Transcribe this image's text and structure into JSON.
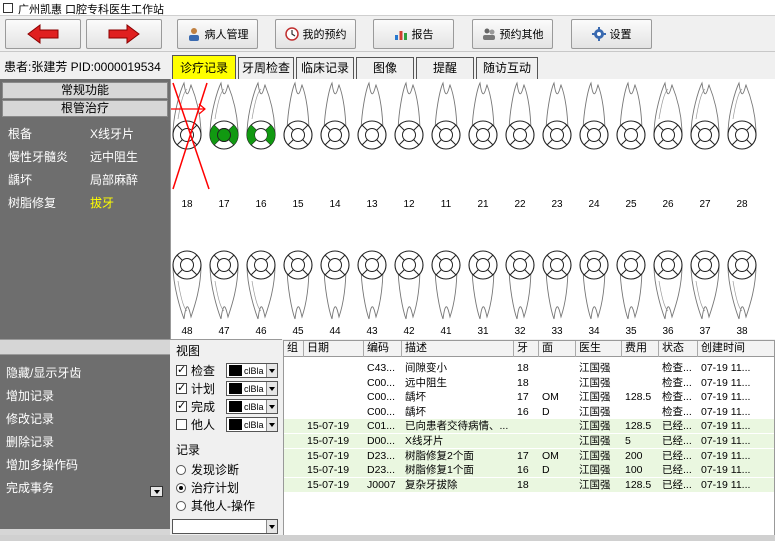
{
  "window": {
    "title": "广州凯惠  口腔专科医生工作站"
  },
  "toolbar": {
    "back_icon": "arrow-left-icon",
    "forward_icon": "arrow-right-icon",
    "buttons": [
      {
        "label": "病人管理",
        "icon": "patient-icon"
      },
      {
        "label": "我的预约",
        "icon": "appointment-icon"
      },
      {
        "label": "报告",
        "icon": "report-icon"
      },
      {
        "label": "预约其他",
        "icon": "schedule-others-icon"
      },
      {
        "label": "设置",
        "icon": "gear-icon"
      }
    ]
  },
  "patient": {
    "info": "患者:张建芳 PID:0000019534"
  },
  "tabs": [
    "诊疗记录",
    "牙周检查",
    "临床记录",
    "图像",
    "提醒",
    "随访互动"
  ],
  "left_panel": {
    "menu_common": "常规功能",
    "menu_root": "根管治疗",
    "procedures_left": [
      "根备",
      "慢性牙髓炎",
      "龋坏",
      "树脂修复"
    ],
    "procedures_right": [
      "X线牙片",
      "远中阻生",
      "局部麻醉",
      "拔牙"
    ],
    "actions": [
      "隐藏/显示牙齿",
      "增加记录",
      "修改记录",
      "删除记录",
      "增加多操作码",
      "完成事务"
    ]
  },
  "teeth": {
    "upper": [
      "18",
      "17",
      "16",
      "15",
      "14",
      "13",
      "12",
      "11",
      "21",
      "22",
      "23",
      "24",
      "25",
      "26",
      "27",
      "28"
    ],
    "lower": [
      "48",
      "47",
      "46",
      "45",
      "44",
      "43",
      "42",
      "41",
      "31",
      "32",
      "33",
      "34",
      "35",
      "36",
      "37",
      "38"
    ],
    "extracted": [
      "18"
    ],
    "filled": [
      "17",
      "16"
    ],
    "fill_color": "#119911",
    "filled_surfaces": {
      "17": "occlusal+distal",
      "16": "distal"
    },
    "mark_color": "#ff0000"
  },
  "view": {
    "title": "视图",
    "checks": [
      {
        "label": "检查",
        "checked": true,
        "color": "clBla"
      },
      {
        "label": "计划",
        "checked": true,
        "color": "clBla"
      },
      {
        "label": "完成",
        "checked": true,
        "color": "clBla"
      },
      {
        "label": "他人",
        "checked": false,
        "color": "clBla"
      }
    ],
    "record_title": "记录",
    "radios": [
      {
        "label": "发现诊断",
        "on": false
      },
      {
        "label": "治疗计划",
        "on": true
      },
      {
        "label": "其他人-操作",
        "on": false
      }
    ]
  },
  "grid": {
    "headers": [
      "组",
      "日期",
      "编码",
      "描述",
      "牙",
      "面",
      "医生",
      "费用",
      "状态",
      "创建时间"
    ],
    "rows": [
      {
        "group": "",
        "date": "",
        "code": "C43...",
        "desc": "间隙变小",
        "tooth": "18",
        "surface": "",
        "doctor": "江国强",
        "fee": "",
        "status": "检查...",
        "created": "07-19 11...",
        "done": false
      },
      {
        "group": "",
        "date": "",
        "code": "C00...",
        "desc": "远中阻生",
        "tooth": "18",
        "surface": "",
        "doctor": "江国强",
        "fee": "",
        "status": "检查...",
        "created": "07-19 11...",
        "done": false
      },
      {
        "group": "",
        "date": "",
        "code": "C00...",
        "desc": "龋坏",
        "tooth": "17",
        "surface": "OM",
        "doctor": "江国强",
        "fee": "128.5",
        "status": "检查...",
        "created": "07-19 11...",
        "done": false
      },
      {
        "group": "",
        "date": "",
        "code": "C00...",
        "desc": "龋坏",
        "tooth": "16",
        "surface": "D",
        "doctor": "江国强",
        "fee": "",
        "status": "检查...",
        "created": "07-19 11...",
        "done": false
      },
      {
        "group": "",
        "date": "15-07-19",
        "code": "C01...",
        "desc": "已向患者交待病情、...",
        "tooth": "",
        "surface": "",
        "doctor": "江国强",
        "fee": "128.5",
        "status": "已经...",
        "created": "07-19 11...",
        "done": true
      },
      {
        "group": "",
        "date": "15-07-19",
        "code": "D00...",
        "desc": "X线牙片",
        "tooth": "",
        "surface": "",
        "doctor": "江国强",
        "fee": "5",
        "status": "已经...",
        "created": "07-19 11...",
        "done": true
      },
      {
        "group": "",
        "date": "15-07-19",
        "code": "D23...",
        "desc": "树脂修复2个面",
        "tooth": "17",
        "surface": "OM",
        "doctor": "江国强",
        "fee": "200",
        "status": "已经...",
        "created": "07-19 11...",
        "done": true
      },
      {
        "group": "",
        "date": "15-07-19",
        "code": "D23...",
        "desc": "树脂修复1个面",
        "tooth": "16",
        "surface": "D",
        "doctor": "江国强",
        "fee": "100",
        "status": "已经...",
        "created": "07-19 11...",
        "done": true
      },
      {
        "group": "",
        "date": "15-07-19",
        "code": "J0007",
        "desc": "复杂牙拔除",
        "tooth": "18",
        "surface": "",
        "doctor": "江国强",
        "fee": "128.5",
        "status": "已经...",
        "created": "07-19 11...",
        "done": true
      }
    ]
  }
}
